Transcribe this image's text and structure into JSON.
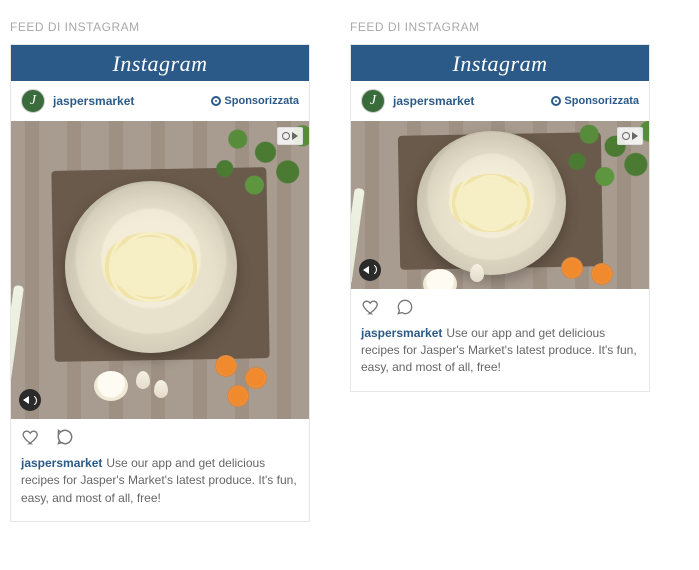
{
  "sections": [
    {
      "label": "FEED DI INSTAGRAM"
    },
    {
      "label": "FEED DI INSTAGRAM"
    }
  ],
  "brand": "Instagram",
  "post": {
    "username": "jaspersmarket",
    "sponsored_label": "Sponsorizzata",
    "avatar_letter": "J",
    "caption_user": "jaspersmarket",
    "caption_text": "Use our app and get delicious recipes for Jasper's Market's latest produce. It's fun, easy, and most of all, free!"
  },
  "colors": {
    "header_bg": "#2c5a88",
    "link": "#2c5a88",
    "muted": "#a9a9a9"
  }
}
